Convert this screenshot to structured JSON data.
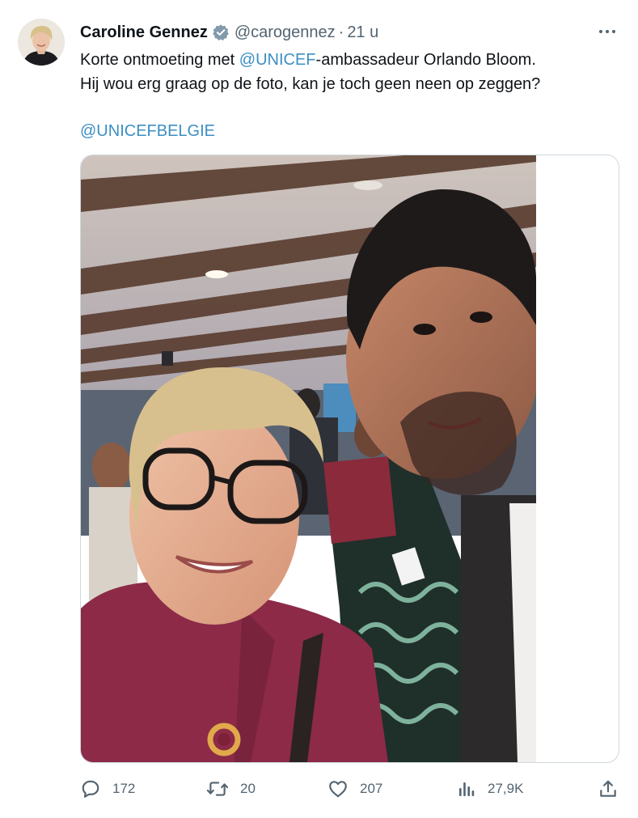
{
  "author": {
    "display_name": "Caroline Gennez",
    "handle": "@carogennez",
    "separator": "·",
    "time": "21 u",
    "verified_icon": "verified-badge-icon"
  },
  "tweet": {
    "line1_pre": "Korte ontmoeting met ",
    "line1_mention": "@UNICEF",
    "line1_post": "-ambassadeur Orlando Bloom.",
    "line2": "Hij wou erg graag op de foto, kan je toch geen neen op zeggen?",
    "tag": "@UNICEFBELGIE"
  },
  "media": {
    "icon": "photo"
  },
  "actions": {
    "reply_count": "172",
    "retweet_count": "20",
    "like_count": "207",
    "views_count": "27,9K"
  },
  "colors": {
    "link": "#3c8fc3",
    "secondary_text": "#536471",
    "verified": "#829aab"
  }
}
